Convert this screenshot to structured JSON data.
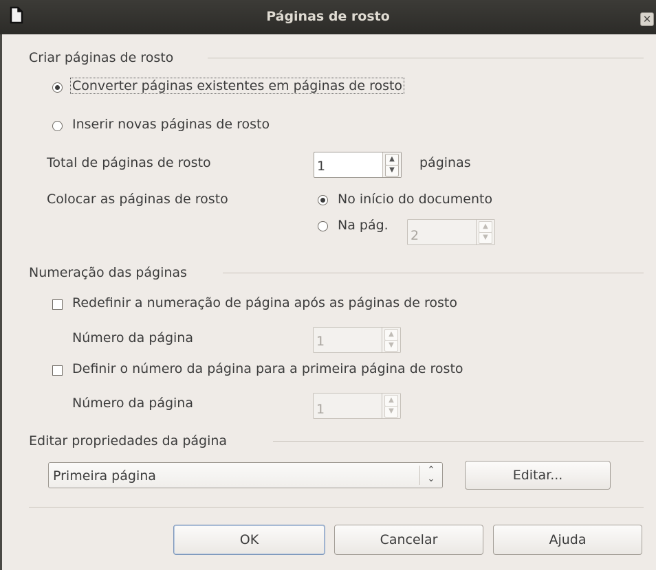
{
  "window": {
    "title": "Páginas de rosto",
    "close_glyph": "✕",
    "icon": "document-icon"
  },
  "create": {
    "heading": "Criar páginas de rosto",
    "convert_label": "Converter páginas existentes em páginas de rosto",
    "convert_checked": true,
    "insert_label": "Inserir novas páginas de rosto",
    "insert_checked": false,
    "total_label": "Total de páginas de rosto",
    "total_value": "1",
    "total_unit": "páginas",
    "place_label": "Colocar as páginas de rosto",
    "place_start_label": "No início do documento",
    "place_start_checked": true,
    "place_page_label": "Na pág.",
    "place_page_checked": false,
    "place_page_value": "2"
  },
  "numbering": {
    "heading": "Numeração das páginas",
    "reset_label": "Redefinir a numeração de página após as páginas de rosto",
    "reset_checked": false,
    "reset_page_label": "Número da página",
    "reset_page_value": "1",
    "first_label": "Definir o número da página para a primeira página de rosto",
    "first_checked": false,
    "first_page_label": "Número da página",
    "first_page_value": "1"
  },
  "properties": {
    "heading": "Editar propriedades da página",
    "page_select_value": "Primeira página",
    "edit_label": "Editar..."
  },
  "footer": {
    "ok_label": "OK",
    "cancel_label": "Cancelar",
    "help_label": "Ajuda"
  }
}
